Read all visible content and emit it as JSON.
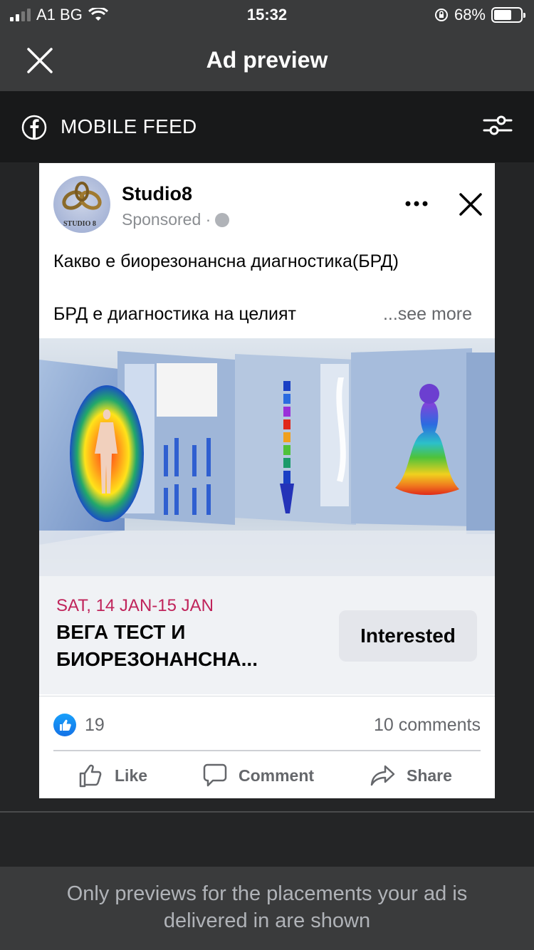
{
  "status_bar": {
    "carrier": "A1 BG",
    "time": "15:32",
    "battery": "68%",
    "battery_level": 0.68
  },
  "header": {
    "title": "Ad preview"
  },
  "placement": {
    "label": "MOBILE FEED"
  },
  "post": {
    "page_name": "Studio8",
    "avatar_text": "STUDIO 8",
    "sponsored": "Sponsored ·",
    "text_line1": "Какво е биорезонансна диагностика(БРД)",
    "text_line2": "БРД е диагностика на целият",
    "see_more": "...see more"
  },
  "event": {
    "date": "SAT, 14 JAN-15 JAN",
    "title": "ВЕГА ТЕСТ И БИОРЕЗОНАНСНА...",
    "interested_label": "Interested"
  },
  "engagement": {
    "reaction_count": "19",
    "comments": "10 comments"
  },
  "actions": {
    "like": "Like",
    "comment": "Comment",
    "share": "Share"
  },
  "footer": {
    "note": "Only previews for the placements your ad is delivered in are shown"
  },
  "colors": {
    "event_date": "#c0245b",
    "like_blue": "#1877f2",
    "topbar": "#3a3b3c"
  }
}
